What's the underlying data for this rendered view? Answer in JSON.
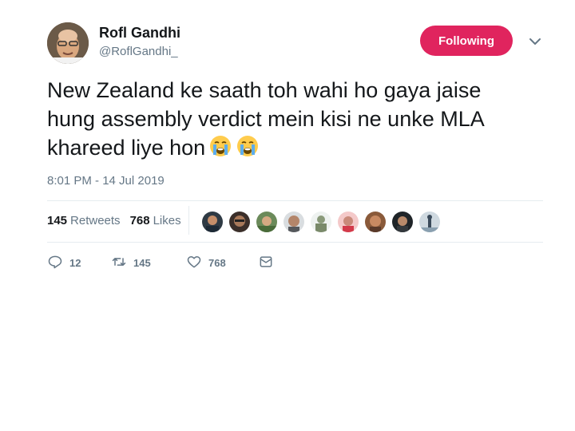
{
  "user": {
    "display_name": "Rofl Gandhi",
    "handle": "@RoflGandhi_"
  },
  "follow_button": {
    "label": "Following",
    "color": "#e0245e"
  },
  "tweet": {
    "text": "New Zealand ke saath toh wahi ho gaya jaise\nhung assembly verdict mein kisi ne unke MLA\nkhareed liye hon",
    "emojis": [
      "loudly-crying-face-emoji",
      "loudly-crying-face-emoji"
    ],
    "timestamp": "8:01 PM - 14 Jul 2019"
  },
  "stats": {
    "retweets_count": "145",
    "retweets_label": "Retweets",
    "likes_count": "768",
    "likes_label": "Likes"
  },
  "likers": [
    "avatar-1",
    "avatar-2",
    "avatar-3",
    "avatar-4",
    "avatar-5",
    "avatar-6",
    "avatar-7",
    "avatar-8",
    "avatar-9"
  ],
  "actions": {
    "reply_count": "12",
    "retweet_count": "145",
    "like_count": "768"
  },
  "colors": {
    "text": "#14171a",
    "secondary": "#657786",
    "divider": "#e6ecf0"
  }
}
